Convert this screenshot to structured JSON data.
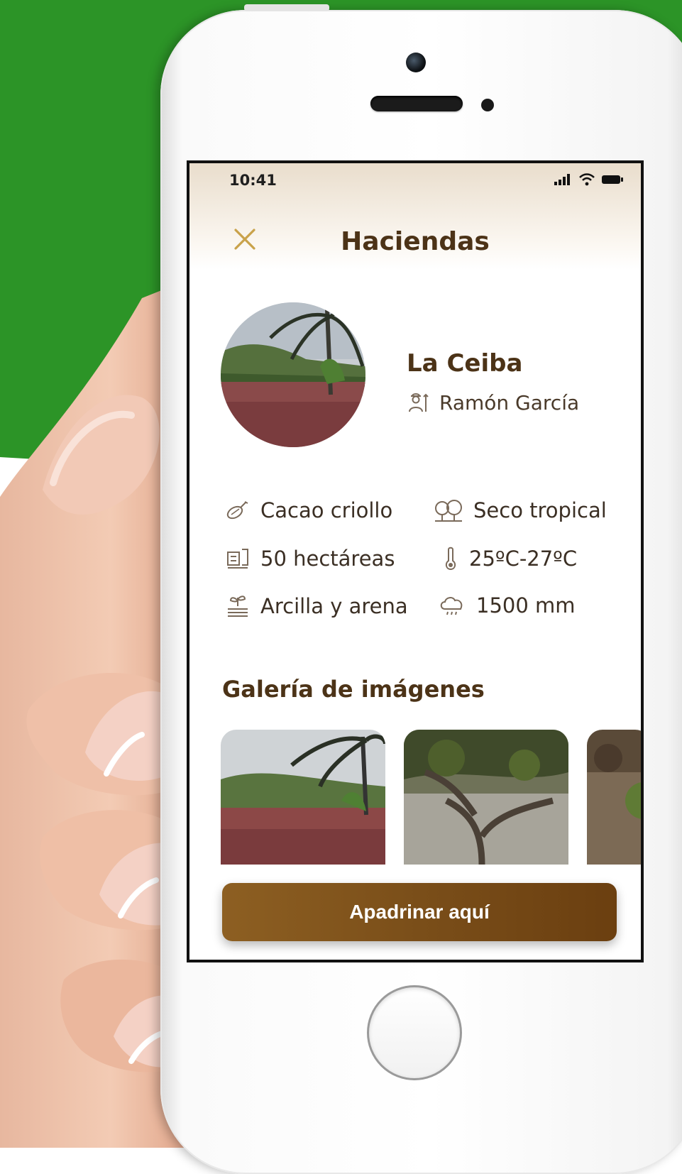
{
  "status_bar": {
    "time": "10:41"
  },
  "header": {
    "close_icon": "close-icon",
    "title": "Haciendas"
  },
  "farm": {
    "name": "La Ceiba",
    "owner": "Ramón García"
  },
  "details": [
    {
      "icon": "cacao-pod-icon",
      "label": "Cacao criollo"
    },
    {
      "icon": "trees-icon",
      "label": "Seco tropical"
    },
    {
      "icon": "land-area-icon",
      "label": "50 hectáreas"
    },
    {
      "icon": "thermometer-icon",
      "label": "25ºC-27ºC"
    },
    {
      "icon": "soil-sprout-icon",
      "label": "Arcilla y arena"
    },
    {
      "icon": "rain-cloud-icon",
      "label": "1500 mm"
    }
  ],
  "gallery": {
    "title": "Galería de imágenes"
  },
  "cta": {
    "label": "Apadrinar aquí"
  },
  "colors": {
    "accent": "#c9a24a",
    "title_brown": "#4c3317",
    "button_brown": "#7a4e19",
    "backdrop_green": "#2c9427"
  }
}
